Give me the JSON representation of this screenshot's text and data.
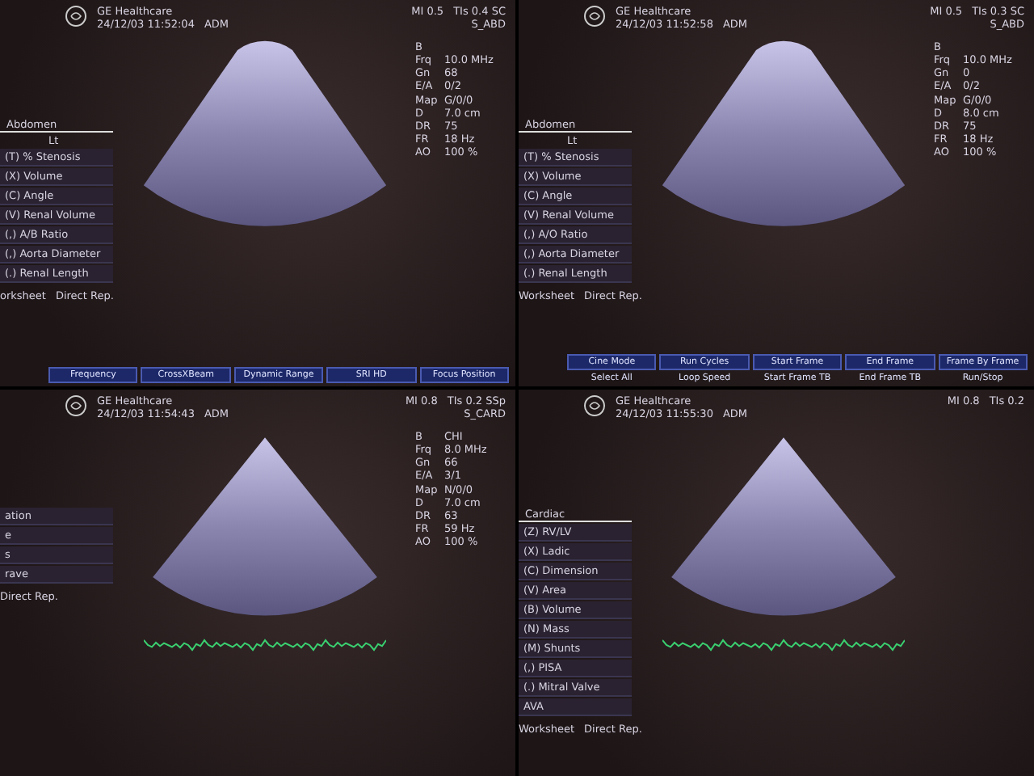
{
  "panels": [
    {
      "kind": "convex",
      "brand": "GE Healthcare",
      "datetime": "24/12/03 11:52:04",
      "user": "ADM",
      "mi": "MI 0.5",
      "tis": "TIs 0.4 SC",
      "preset": "S_ABD",
      "params": [
        {
          "k": "B"
        },
        {
          "k": "Frq",
          "v": "10.0 MHz"
        },
        {
          "k": "Gn",
          "v": "68"
        },
        {
          "k": "E/A",
          "v": "0/2"
        },
        {
          "k": "Map",
          "v": "G/0/0"
        },
        {
          "k": "D",
          "v": "7.0 cm"
        },
        {
          "k": "DR",
          "v": "75"
        },
        {
          "k": "FR",
          "v": "18 Hz"
        },
        {
          "k": "AO",
          "v": "100 %"
        }
      ],
      "menu_title": "Abdomen",
      "menu_side": "Lt",
      "menu": [
        "(T) % Stenosis",
        "(X) Volume",
        "(C) Angle",
        "(V) Renal Volume",
        "(,) A/B Ratio",
        "(,) Aorta Diameter",
        "(.) Renal Length"
      ],
      "footer": [
        "orksheet",
        "Direct Rep."
      ],
      "ecg": false,
      "softkeys": [
        "Frequency",
        "CrossXBeam",
        "Dynamic Range",
        "SRI HD",
        "Focus Position"
      ]
    },
    {
      "kind": "convex",
      "brand": "GE Healthcare",
      "datetime": "24/12/03 11:52:58",
      "user": "ADM",
      "mi": "MI 0.5",
      "tis": "TIs 0.3 SC",
      "preset": "S_ABD",
      "params": [
        {
          "k": "B"
        },
        {
          "k": "Frq",
          "v": "10.0 MHz"
        },
        {
          "k": "Gn",
          "v": "0"
        },
        {
          "k": "E/A",
          "v": "0/2"
        },
        {
          "k": "Map",
          "v": "G/0/0"
        },
        {
          "k": "D",
          "v": "8.0 cm"
        },
        {
          "k": "DR",
          "v": "75"
        },
        {
          "k": "FR",
          "v": "18 Hz"
        },
        {
          "k": "AO",
          "v": "100 %"
        }
      ],
      "menu_title": "Abdomen",
      "menu_side": "Lt",
      "menu": [
        "(T) % Stenosis",
        "(X) Volume",
        "(C) Angle",
        "(V) Renal Volume",
        "(,) A/O Ratio",
        "(,) Aorta Diameter",
        "(.) Renal Length"
      ],
      "footer": [
        "Worksheet",
        "Direct Rep."
      ],
      "ecg": false,
      "softkeys": [
        "Cine Mode",
        "Run Cycles",
        "Start Frame",
        "End Frame",
        "Frame By Frame"
      ],
      "softkeys2": [
        "Select All",
        "Loop Speed",
        "Start Frame TB",
        "End Frame TB",
        "Run/Stop"
      ]
    },
    {
      "kind": "sector",
      "brand": "GE Healthcare",
      "datetime": "24/12/03 11:54:43",
      "user": "ADM",
      "mi": "MI 0.8",
      "tis": "TIs 0.2 SSp",
      "preset": "S_CARD",
      "params": [
        {
          "k": "B",
          "v": "CHI"
        },
        {
          "k": "Frq",
          "v": "8.0 MHz"
        },
        {
          "k": "Gn",
          "v": "66"
        },
        {
          "k": "E/A",
          "v": "3/1"
        },
        {
          "k": "Map",
          "v": "N/0/0"
        },
        {
          "k": "D",
          "v": "7.0 cm"
        },
        {
          "k": "DR",
          "v": "63"
        },
        {
          "k": "FR",
          "v": "59 Hz"
        },
        {
          "k": "AO",
          "v": "100 %"
        }
      ],
      "menu": [
        "ation",
        "e",
        "s",
        "rave"
      ],
      "footer": [
        "Direct Rep."
      ],
      "ecg": true
    },
    {
      "kind": "sector",
      "brand": "GE Healthcare",
      "datetime": "24/12/03 11:55:30",
      "user": "ADM",
      "mi": "MI 0.8",
      "tis": "TIs 0.2",
      "menu_title": "Cardiac",
      "menu": [
        "(Z) RV/LV",
        "(X) Ladic",
        "(C) Dimension",
        "(V) Area",
        "(B) Volume",
        "(N) Mass",
        "(M) Shunts",
        "(,) PISA",
        "(.) Mitral Valve",
        "AVA"
      ],
      "footer": [
        "Worksheet",
        "Direct Rep."
      ],
      "ecg": true
    }
  ]
}
